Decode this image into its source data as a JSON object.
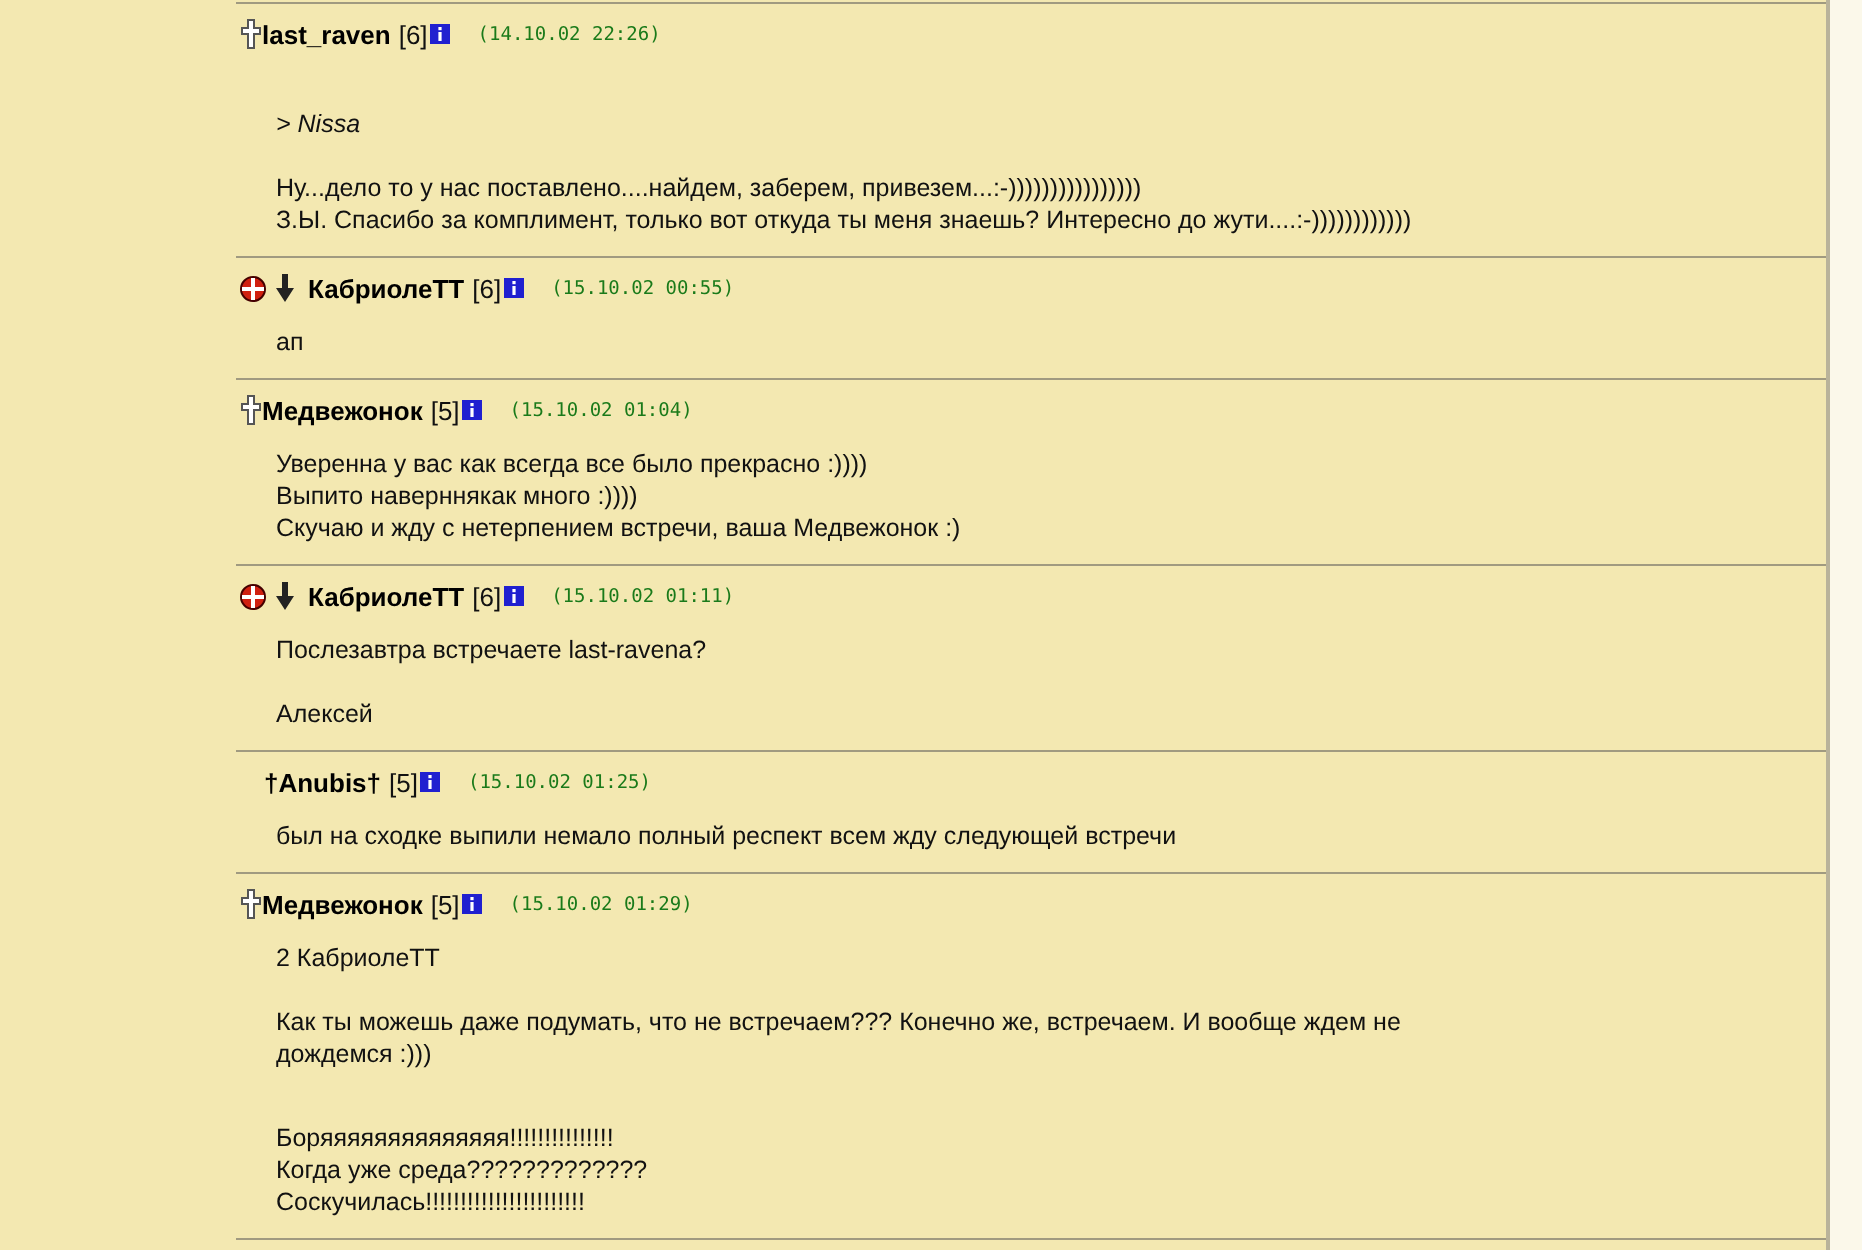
{
  "posts": [
    {
      "icons": [
        {
          "kind": "cross"
        }
      ],
      "author": "last_raven",
      "rank": "[6]",
      "date": "(14.10.02 22:26)",
      "paragraphs": [
        {
          "kind": "quote",
          "lines": [
            "> Nissa"
          ]
        },
        {
          "kind": "text",
          "lines": [
            "Ну...дело то у нас поставлено....найдем, заберем, привезем...:-))))))))))))))))",
            "З.Ы. Спасибо за комплимент, только вот откуда ты меня знаешь? Интересно до жути....:-))))))))))))"
          ]
        }
      ]
    },
    {
      "icons": [
        {
          "kind": "badge"
        },
        {
          "kind": "arrow"
        }
      ],
      "author": "КабриолеТТ",
      "rank": "[6]",
      "date": "(15.10.02 00:55)",
      "paragraphs": [
        {
          "kind": "text",
          "lines": [
            "ап"
          ]
        }
      ]
    },
    {
      "icons": [
        {
          "kind": "cross"
        }
      ],
      "author": "Медвежонок",
      "rank": "[5]",
      "date": "(15.10.02 01:04)",
      "paragraphs": [
        {
          "kind": "text",
          "lines": [
            "Уверенна у вас как всегда все было прекрасно :))))",
            "Выпито наверннякак много :))))",
            "Скучаю и жду с нетерпением встречи, ваша Медвежонок :)"
          ]
        }
      ]
    },
    {
      "icons": [
        {
          "kind": "badge"
        },
        {
          "kind": "arrow"
        }
      ],
      "author": "КабриолеТТ",
      "rank": "[6]",
      "date": "(15.10.02 01:11)",
      "paragraphs": [
        {
          "kind": "text",
          "lines": [
            "Послезавтра встречаете last-ravena?"
          ]
        },
        {
          "kind": "text",
          "lines": [
            "Алексей"
          ]
        }
      ]
    },
    {
      "author": "†Anubis†",
      "rank": "[5]",
      "date": "(15.10.02 01:25)",
      "paragraphs": [
        {
          "kind": "text",
          "lines": [
            "был на сходке выпили немало полный респект всем жду следующей встречи"
          ]
        }
      ]
    },
    {
      "icons": [
        {
          "kind": "cross"
        }
      ],
      "author": "Медвежонок",
      "rank": "[5]",
      "date": "(15.10.02 01:29)",
      "paragraphs": [
        {
          "kind": "text",
          "lines": [
            "2 КабриолеТТ"
          ]
        },
        {
          "kind": "text",
          "lines": [
            "Как ты можешь даже подумать, что не встречаем??? Конечно же, встречаем. И вообще ждем не",
            "дождемся :)))"
          ]
        },
        {
          "kind": "spaced",
          "lines": [
            "Боряяяяяяяяяяяяяя!!!!!!!!!!!!!!!",
            "Когда уже среда?????????????",
            "Соскучилась!!!!!!!!!!!!!!!!!!!!!!!"
          ]
        }
      ]
    }
  ]
}
